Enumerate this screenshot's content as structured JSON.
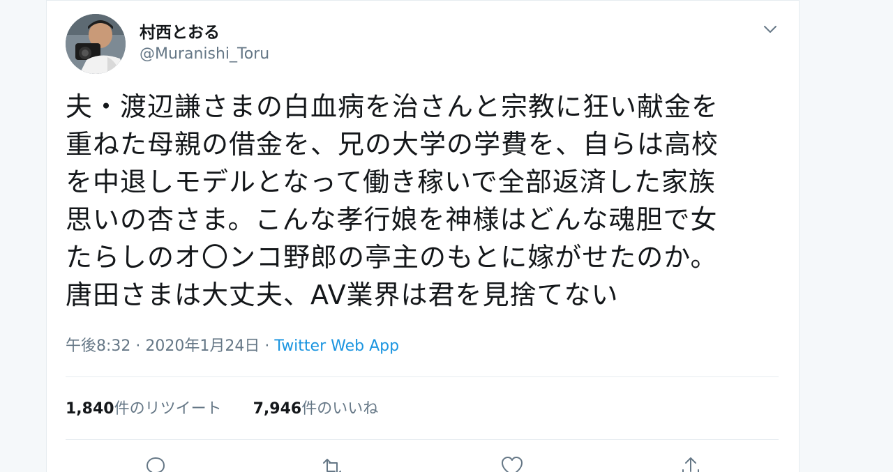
{
  "user": {
    "display_name": "村西とおる",
    "handle": "@Muranishi_Toru"
  },
  "tweet": {
    "text_lines": [
      "夫・渡辺謙さまの白血病を治さんと宗教に狂い献金を",
      "重ねた母親の借金を、兄の大学の学費を、自らは高校",
      "を中退しモデルとなって働き稼いで全部返済した家族",
      "思いの杏さま。こんな孝行娘を神様はどんな魂胆で女",
      "たらしのオ〇ンコ野郎の亭主のもとに嫁がせたのか。",
      "唐田さまは大丈夫、AV業界は君を見捨てない"
    ],
    "time": "午後8:32",
    "separator": "·",
    "date": "2020年1月24日",
    "source": "Twitter Web App"
  },
  "stats": {
    "retweets_count": "1,840",
    "retweets_label": "件のリツイート",
    "likes_count": "7,946",
    "likes_label": "件のいいね"
  },
  "icons": {
    "caret": "chevron-down-icon",
    "reply": "reply-icon",
    "retweet": "retweet-icon",
    "like": "heart-icon",
    "share": "share-icon"
  },
  "colors": {
    "text": "#14171a",
    "secondary": "#657786",
    "link": "#1b95e0",
    "border": "#e6ecf0"
  }
}
